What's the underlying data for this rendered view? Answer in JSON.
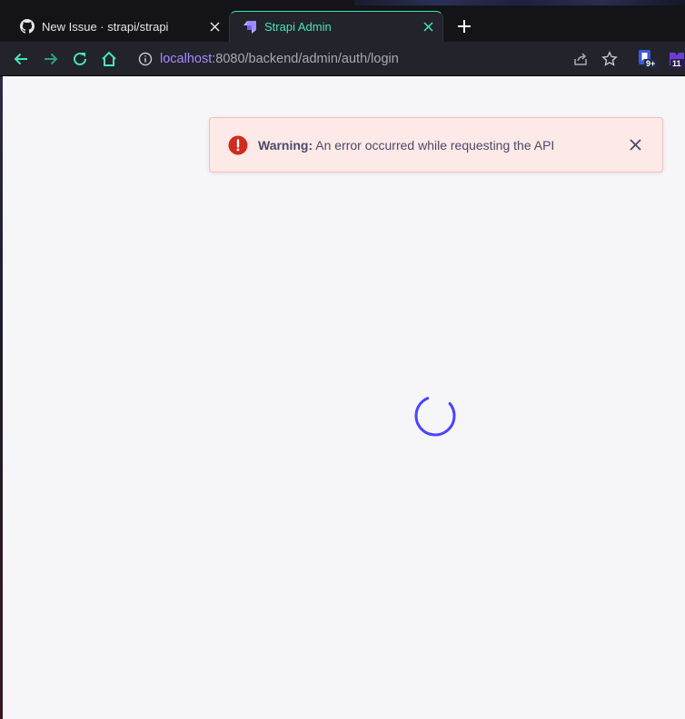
{
  "browser": {
    "tabs": [
      {
        "title": "New Issue · strapi/strapi",
        "favicon": "github-icon",
        "active": false
      },
      {
        "title": "Strapi Admin",
        "favicon": "strapi-icon",
        "active": true
      }
    ],
    "address": {
      "host": "localhost",
      "rest": ":8080/backend/admin/auth/login"
    },
    "extensions": [
      {
        "name": "bookmark-extension-icon",
        "badge": "9+"
      },
      {
        "name": "puzzle-extension-icon",
        "badge": "11"
      }
    ],
    "accent": "#45e6b4"
  },
  "alert": {
    "label": "Warning:",
    "message": "An error occurred while requesting the API",
    "icon": "error-icon",
    "color": "#d02b20"
  },
  "page": {
    "loader": "spinner",
    "accent": "#4945ff"
  }
}
